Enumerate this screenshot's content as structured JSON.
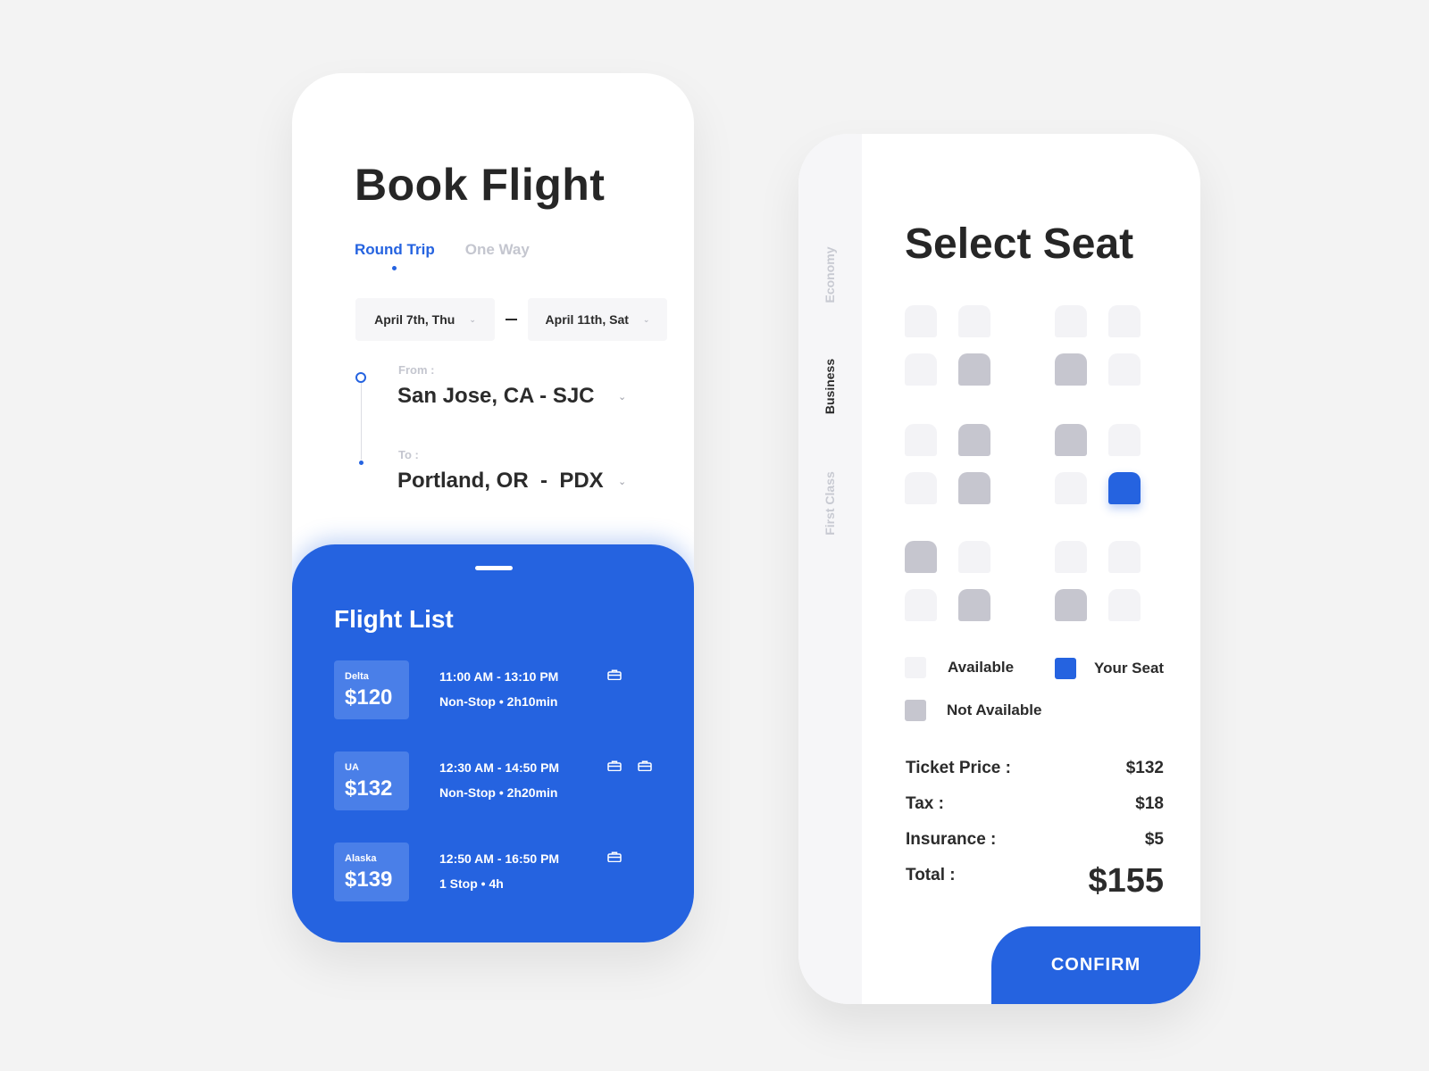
{
  "book_flight": {
    "title": "Book Flight",
    "tabs": [
      {
        "label": "Round Trip",
        "active": true
      },
      {
        "label": "One Way",
        "active": false
      }
    ],
    "dates": {
      "depart": "April 7th, Thu",
      "return": "April 11th, Sat"
    },
    "from": {
      "label": "From :",
      "value": "San Jose, CA - SJC"
    },
    "to": {
      "label": "To :",
      "value": "Portland, OR  -  PDX"
    }
  },
  "flight_list": {
    "title": "Flight List",
    "flights": [
      {
        "airline": "Delta",
        "price": "$120",
        "times": "11:00 AM - 13:10 PM",
        "details": "Non-Stop • 2h10min",
        "bags": 1
      },
      {
        "airline": "UA",
        "price": "$132",
        "times": "12:30 AM - 14:50 PM",
        "details": "Non-Stop • 2h20min",
        "bags": 2
      },
      {
        "airline": "Alaska",
        "price": "$139",
        "times": "12:50 AM - 16:50 PM",
        "details": "1 Stop • 4h",
        "bags": 1
      }
    ]
  },
  "select_seat": {
    "title": "Select Seat",
    "classes": [
      {
        "label": "Economy",
        "active": false
      },
      {
        "label": "Business",
        "active": true
      },
      {
        "label": "First Class",
        "active": false
      }
    ],
    "seat_rows": [
      [
        "available",
        "available",
        "available",
        "available"
      ],
      [
        "available",
        "taken",
        "taken",
        "available"
      ],
      [
        "available",
        "taken",
        "taken",
        "available"
      ],
      [
        "available",
        "taken",
        "available",
        "mine"
      ],
      [
        "taken",
        "available",
        "available",
        "available"
      ],
      [
        "available",
        "taken",
        "taken",
        "available"
      ]
    ],
    "legend": {
      "available": "Available",
      "your_seat": "Your Seat",
      "not_available": "Not Available"
    },
    "fees": [
      {
        "label": "Ticket Price :",
        "value": "$132"
      },
      {
        "label": "Tax :",
        "value": "$18"
      },
      {
        "label": "Insurance :",
        "value": "$5"
      }
    ],
    "total": {
      "label": "Total :",
      "value": "$155"
    },
    "confirm_label": "CONFIRM"
  },
  "colors": {
    "accent": "#2563e0",
    "seat_available": "#f3f3f6",
    "seat_taken": "#c6c6cf",
    "background": "#f3f3f3"
  },
  "icons": {
    "baggage": "briefcase-icon",
    "dropdown": "chevron-down-icon"
  }
}
